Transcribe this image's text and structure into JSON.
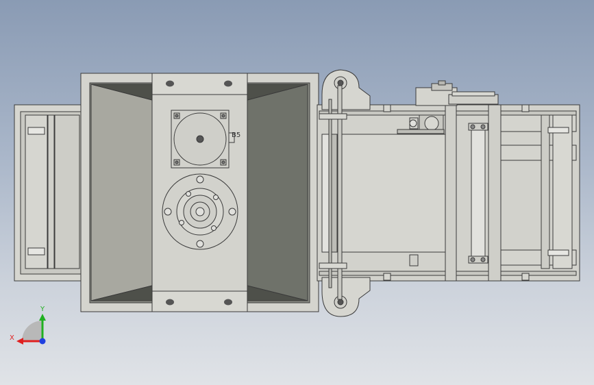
{
  "triad": {
    "x_label": "X",
    "y_label": "Y",
    "colors": {
      "x": "#e02020",
      "y": "#20b020",
      "z": "#2040e0"
    }
  },
  "motor_label": "B5",
  "colors": {
    "frame": "#d6d6d0",
    "outline": "#3a3a3a",
    "hopper_light": "#a8a8a0",
    "hopper_dark": "#6f726a"
  }
}
